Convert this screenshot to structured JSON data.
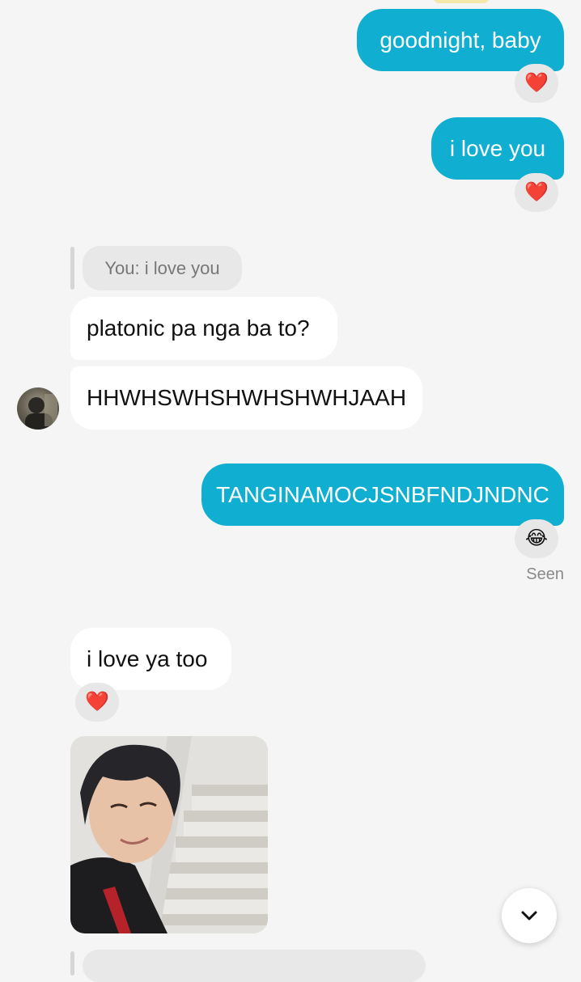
{
  "messages": {
    "m1": {
      "text": "goodnight, baby",
      "reaction": "❤️"
    },
    "m2": {
      "text": "i love you",
      "reaction": "❤️"
    },
    "reply_context": "You: i love you",
    "m3": {
      "text": "platonic pa nga ba to?"
    },
    "m4": {
      "text": "HHWHSWHSHWHSHWHJAAH"
    },
    "m5": {
      "text": "TANGINAMOCJSNBFNDJNDNC",
      "reaction": "😂",
      "status": "Seen"
    },
    "m6": {
      "text": "i love ya too",
      "reaction": "❤️"
    }
  },
  "colors": {
    "outgoing_bubble": "#10aed0",
    "incoming_bubble": "#ffffff",
    "background": "#f5f5f5"
  },
  "icons": {
    "scroll_down": "chevron-down-icon"
  }
}
